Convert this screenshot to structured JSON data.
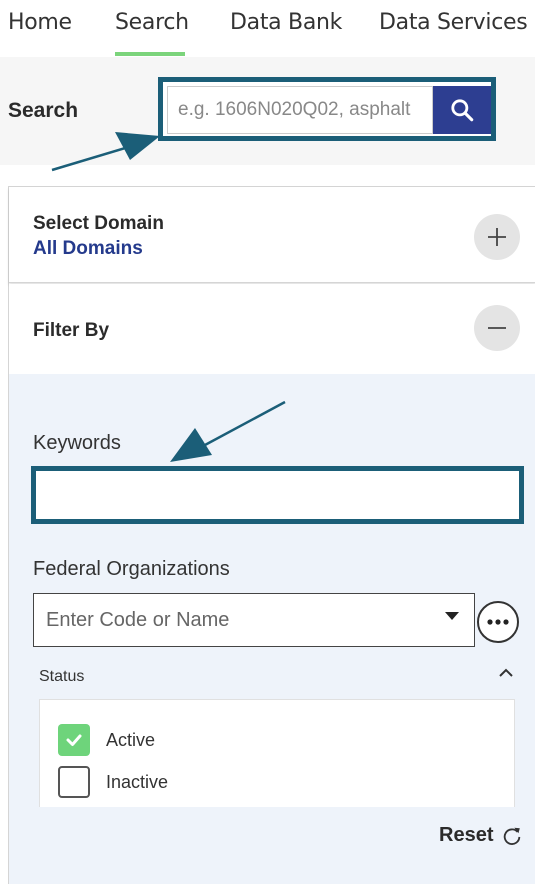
{
  "nav": {
    "items": [
      {
        "label": "Home"
      },
      {
        "label": "Search"
      },
      {
        "label": "Data Bank"
      },
      {
        "label": "Data Services"
      }
    ],
    "active": "Search",
    "accent_color": "#7bd47b"
  },
  "search": {
    "label": "Search",
    "placeholder": "e.g. 1606N020Q02, asphalt",
    "button_icon": "search-icon",
    "button_color": "#2d3e91"
  },
  "domain": {
    "title": "Select Domain",
    "value": "All Domains",
    "toggle_icon": "plus-icon"
  },
  "filter": {
    "title": "Filter By",
    "toggle_icon": "minus-icon",
    "keywords": {
      "label": "Keywords",
      "value": ""
    },
    "federal_orgs": {
      "label": "Federal Organizations",
      "placeholder": "Enter Code or Name",
      "more_icon": "more-dots-icon"
    },
    "status": {
      "label": "Status",
      "options": [
        {
          "label": "Active",
          "checked": true
        },
        {
          "label": "Inactive",
          "checked": false
        }
      ]
    },
    "reset_label": "Reset"
  },
  "annotation_color": "#1b5e78"
}
